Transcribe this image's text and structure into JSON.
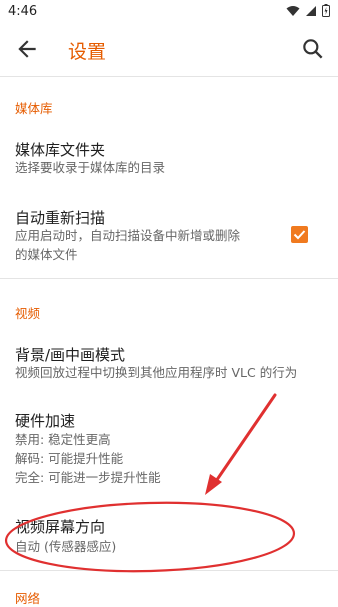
{
  "status": {
    "time": "4:46"
  },
  "app_bar": {
    "title": "设置"
  },
  "sections": {
    "library": {
      "header": "媒体库",
      "folders_title": "媒体库文件夹",
      "folders_summary": "选择要收录于媒体库的目录",
      "rescan_title": "自动重新扫描",
      "rescan_summary_1": "应用启动时，自动扫描设备中新增或删除",
      "rescan_summary_2": "的媒体文件",
      "rescan_checked": true
    },
    "video": {
      "header": "视频",
      "pip_title": "背景/画中画模式",
      "pip_summary": "视频回放过程中切换到其他应用程序时 VLC 的行为",
      "hw_title": "硬件加速",
      "hw_line1": "禁用: 稳定性更高",
      "hw_line2": "解码: 可能提升性能",
      "hw_line3": "完全: 可能进一步提升性能",
      "orientation_title": "视频屏幕方向",
      "orientation_summary": "自动 (传感器感应)"
    },
    "next_header": "网络"
  },
  "colors": {
    "accent": "#e65c00",
    "annotation": "#e03030"
  }
}
